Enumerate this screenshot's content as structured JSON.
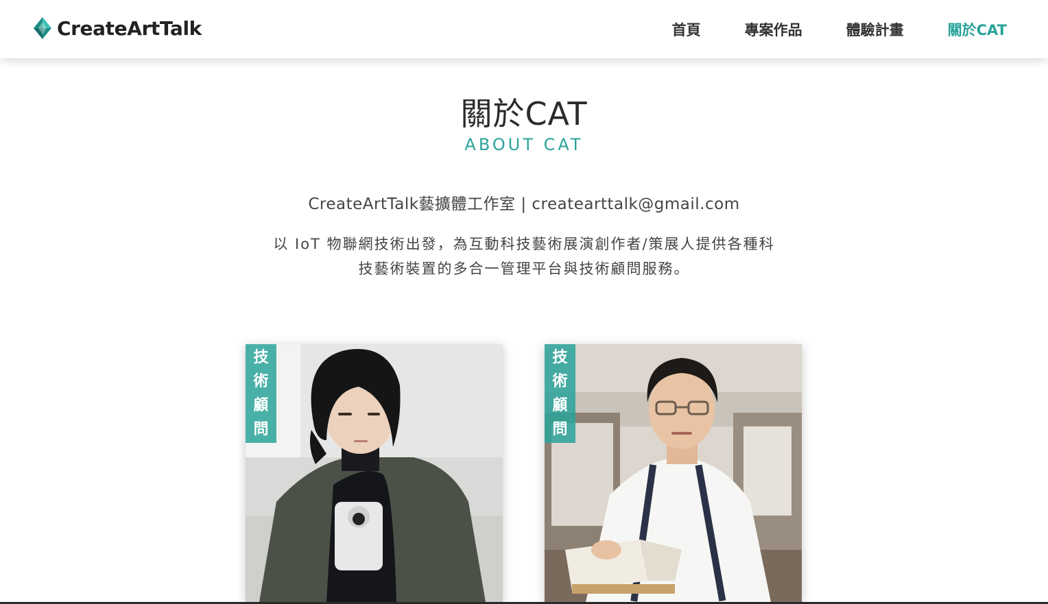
{
  "header": {
    "brand": "CreateArtTalk",
    "brand_icon": "diamond-logo-icon",
    "accent_color": "#2aa39a",
    "nav": [
      {
        "label": "首頁",
        "active": false
      },
      {
        "label": "專案作品",
        "active": false
      },
      {
        "label": "體驗計畫",
        "active": false
      },
      {
        "label": "關於CAT",
        "active": true
      }
    ]
  },
  "main": {
    "title": "關於CAT",
    "subtitle": "ABOUT CAT",
    "contact": "CreateArtTalk藝擴體工作室 | createarttalk@gmail.com",
    "description_line1": "以 IoT 物聯網技術出發，為互動科技藝術展演創作者/策展人提供各種科",
    "description_line2": "技藝術裝置的多合一管理平台與技術顧問服務。"
  },
  "cards": [
    {
      "tag": [
        "技",
        "術",
        "顧",
        "問"
      ]
    },
    {
      "tag": [
        "技",
        "術",
        "顧",
        "問"
      ]
    }
  ]
}
